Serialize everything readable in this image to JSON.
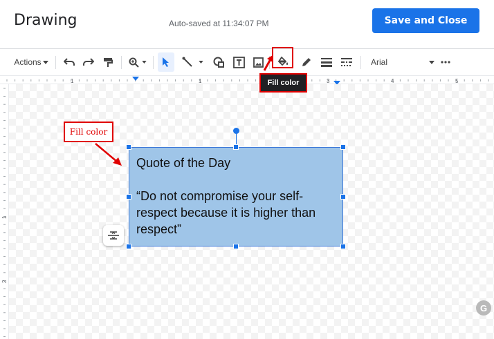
{
  "header": {
    "title": "Drawing",
    "autosave": "Auto-saved at 11:34:07 PM",
    "save_label": "Save and Close"
  },
  "toolbar": {
    "actions_label": "Actions",
    "font": "Arial",
    "tooltip": "Fill color",
    "tools": [
      "undo-icon",
      "redo-icon",
      "paint-format-icon",
      "zoom-icon",
      "select-icon",
      "line-icon",
      "shape-icon",
      "text-box-icon",
      "image-icon",
      "fill-color-icon",
      "border-color-icon",
      "border-weight-icon",
      "border-dash-icon",
      "more-icon"
    ]
  },
  "ruler": {
    "labels": [
      "1",
      "1",
      "2",
      "3",
      "4",
      "5"
    ]
  },
  "vruler": {
    "labels": [
      "1",
      "2"
    ]
  },
  "shape": {
    "title": "Quote of the Day",
    "quote": "“Do not compromise your self-respect because it is higher than respect”",
    "fill_color": "#9fc5e8",
    "border_color": "#3c78d8"
  },
  "annotation": {
    "label": "Fill color",
    "color": "#e00000"
  },
  "colors": {
    "accent": "#1a73e8"
  }
}
